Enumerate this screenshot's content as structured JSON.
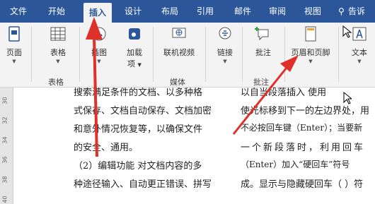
{
  "tabs": [
    "文件",
    "开始",
    "插入",
    "设计",
    "布局",
    "引用",
    "邮件",
    "审阅",
    "视图",
    "告诉"
  ],
  "ribbon": {
    "page": "页面",
    "table": "表格",
    "picture": "插图",
    "addin_l1": "加载",
    "addin_l2": "项",
    "video": "联机视频",
    "link": "链接",
    "comment": "批注",
    "headerfooter": "页眉和页脚",
    "text": "文本",
    "group_table": "表格",
    "group_media": "媒体",
    "group_comment": "批注"
  },
  "ruler": [
    "30",
    "32",
    "34",
    "36",
    "38",
    "40"
  ],
  "left_lines": [
    "搜索满足条件的文档、以多种格",
    "式保存、文档自动保存、文档加密",
    "和意外情况恢复等，以确保文件",
    "的安全、通用。",
    "（2）编辑功能 对文档内容的多",
    "种途径输入、自动更正错误、拼写"
  ],
  "right_lines": [
    "以自当段落插入   使用",
    "使光标移到下一的左边界处，用",
    "不必按回车键（Enter）；当要新",
    "一个新段落时，利用回车",
    "（Enter）加入“硬回车”符号",
    "成。显示与隐藏硬回车（ ）符"
  ]
}
